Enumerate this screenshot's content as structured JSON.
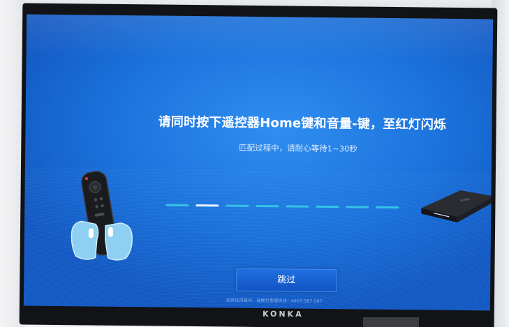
{
  "screen": {
    "title": "请同时按下遥控器Home键和音量-键，至红灯闪烁",
    "subtitle": "匹配过程中，请耐心等待1~30秒",
    "progress": {
      "total_steps": 8,
      "active_step": 2
    },
    "skip_label": "跳过",
    "hotline_text": "如有任何疑问，请拨打客服热线：4007-567-567"
  },
  "tv": {
    "brand": "KONKA"
  },
  "colors": {
    "screen_bg": "#1c73dc",
    "dash_idle": "#35c3e6",
    "dash_active": "#e7f4ff",
    "button_bg": "#1354c4"
  },
  "icons": {
    "remote": "remote-control-in-hands-icon",
    "set_top_box": "set-top-box-icon"
  }
}
